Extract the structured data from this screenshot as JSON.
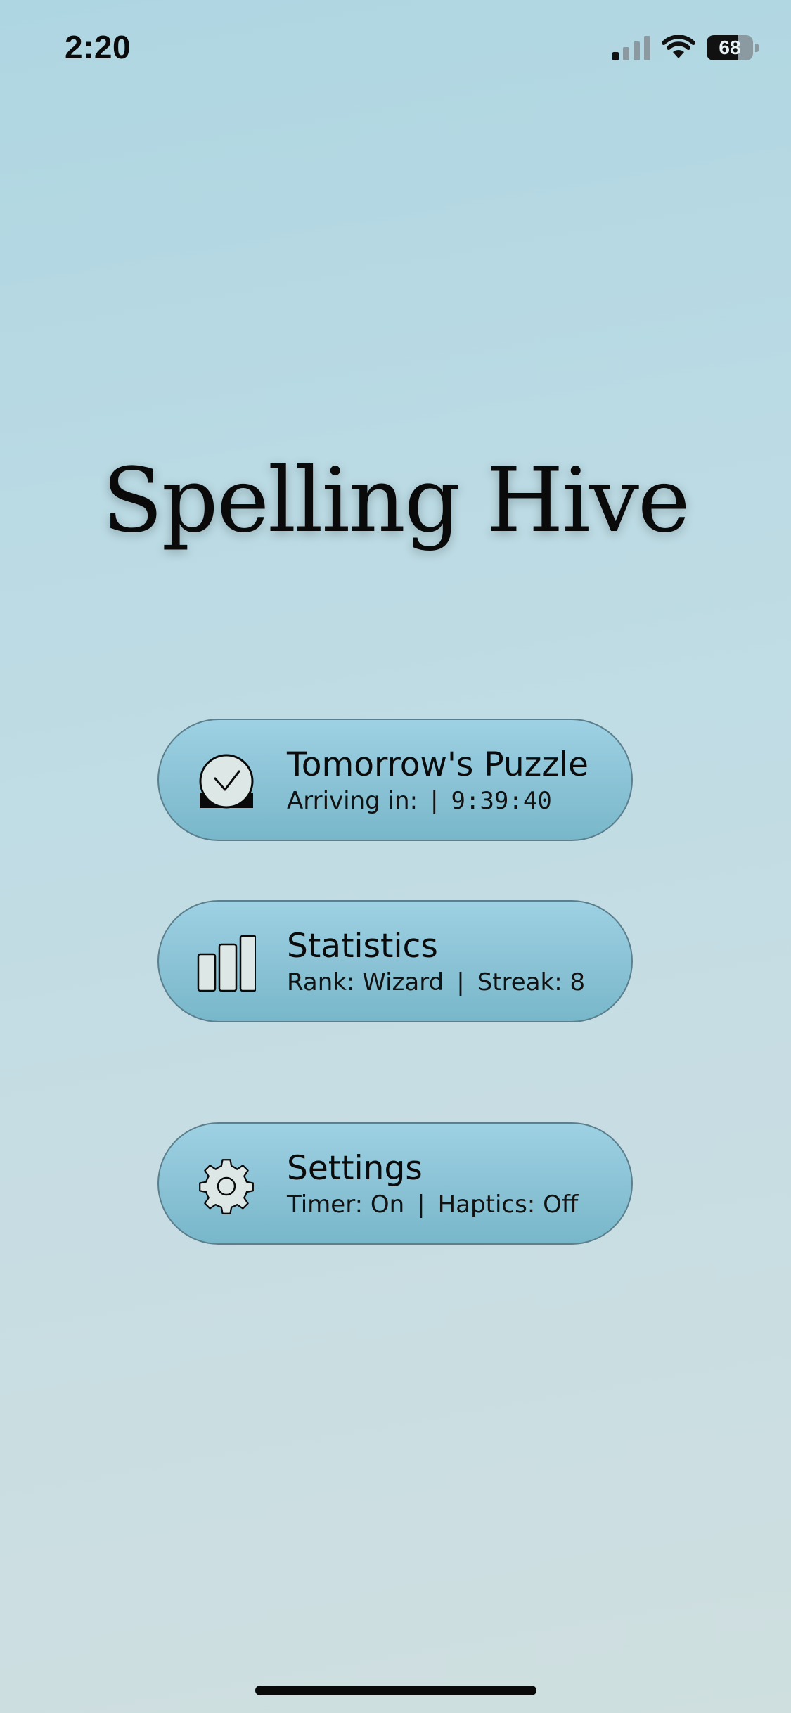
{
  "status_bar": {
    "time": "2:20",
    "battery_level": "68"
  },
  "app": {
    "title": "Spelling Hive"
  },
  "menu": {
    "puzzle": {
      "title": "Tomorrow's Puzzle",
      "label": "Arriving in:",
      "separator": "|",
      "countdown": "9:39:40",
      "icon": "clock-icon"
    },
    "stats": {
      "title": "Statistics",
      "rank": "Rank: Wizard",
      "separator": "|",
      "streak": "Streak: 8",
      "icon": "bar-chart-icon"
    },
    "settings": {
      "title": "Settings",
      "timer": "Timer: On",
      "separator": "|",
      "haptics": "Haptics: Off",
      "icon": "gear-icon"
    }
  },
  "colors": {
    "button_top": "#9dd1e3",
    "button_bottom": "#78b7ca",
    "button_border": "#5b7f8c",
    "icon_fill": "#dde8e6"
  }
}
